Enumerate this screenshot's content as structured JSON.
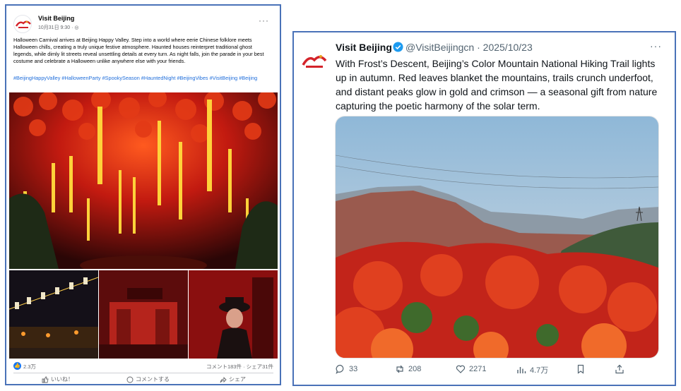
{
  "facebook_post": {
    "page_name": "Visit Beijing",
    "date": "10月31日 9:30",
    "privacy_symbol": "·",
    "body": "Halloween Carnival arrives at Beijing Happy Valley. Step into a world where eerie Chinese folklore meets Halloween chills, creating a truly unique festive atmosphere. Haunted houses reinterpret traditional ghost legends, while dimly lit streets reveal unsettling details at every turn. As night falls, join the parade in your best costume and celebrate a Halloween unlike anywhere else with your friends.",
    "hashtags": "#BeijingHappyValley #HalloweenParty #SpookySeason #HauntedNight #BeijingVibes #VisitBeijing #Beijing",
    "reaction_count": "2.3万",
    "comment_share_summary": "コメント183件 · シェア31件",
    "like_label": "いいね！",
    "comment_label": "コメントする",
    "share_label": "シェア",
    "more_symbol": "···",
    "like_badge_symbol": "👍"
  },
  "tweet": {
    "display_name": "Visit Beijing",
    "handle_date": "@VisitBeijingcn · 2025/10/23",
    "text": "With Frost’s Descent, Beijing’s Color Mountain National Hiking Trail lights up in autumn. Red leaves blanket the mountains, trails crunch underfoot, and distant peaks glow in gold and crimson — a seasonal gift from nature capturing the poetic harmony of the solar term.",
    "more_symbol": "···",
    "replies": "33",
    "retweets": "208",
    "likes": "2271",
    "views": "4.7万",
    "verified_color": "#1d9bf0"
  },
  "colors": {
    "facebook_blue": "#1877f2",
    "hashtag_blue": "#216fdb",
    "frame_border": "#4a72b8"
  }
}
